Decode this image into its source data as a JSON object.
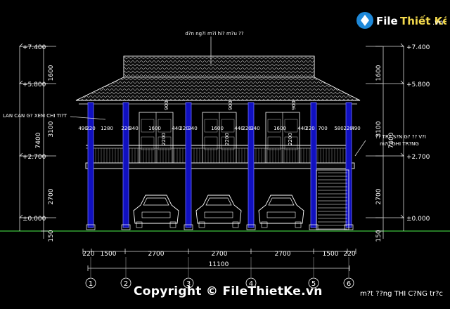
{
  "brand": {
    "logo_text_left": "File",
    "logo_text_right": "Thiết Kế",
    "logo_suffix": ".vn",
    "copyright": "Copyright © FileThietKe.vn"
  },
  "caption": "m?t ??ng THI C?NG tr?c",
  "annotations": {
    "roof_note": "d?n ng?i m?i hi? m?u ??",
    "left_note": "LAN CAN G? XEM CHI TI?T",
    "right_note_1": "?? TR? S?N G? ?? V?I",
    "right_note_2": "m?u GHI TR?NG"
  },
  "levels": {
    "left": [
      "+7.400",
      "+5.800",
      "+2.700",
      "±0.000"
    ],
    "right": [
      "+7.400",
      "+5.800",
      "+2.700",
      "±0.000"
    ]
  },
  "vertical_dims": {
    "left": [
      "1600",
      "3100",
      "7400",
      "2700",
      "150"
    ],
    "right": [
      "1600",
      "3100",
      "7400",
      "2700",
      "150"
    ]
  },
  "door_dims": {
    "door_heights": [
      "900",
      "900",
      "900"
    ],
    "window_heights": [
      "2200",
      "2200",
      "2200"
    ],
    "upper_row": [
      "490",
      "220",
      "1280",
      "220",
      "340",
      "1600",
      "440",
      "220",
      "340",
      "1600",
      "440",
      "220",
      "340",
      "1600",
      "440",
      "220",
      "700",
      "580",
      "220",
      "490"
    ]
  },
  "horizontal_dims": {
    "spans": [
      "220",
      "1500",
      "2700",
      "2700",
      "2700",
      "1500",
      "220"
    ],
    "total": "11100"
  },
  "grid_axes": [
    "1",
    "2",
    "3",
    "4",
    "5",
    "6"
  ]
}
